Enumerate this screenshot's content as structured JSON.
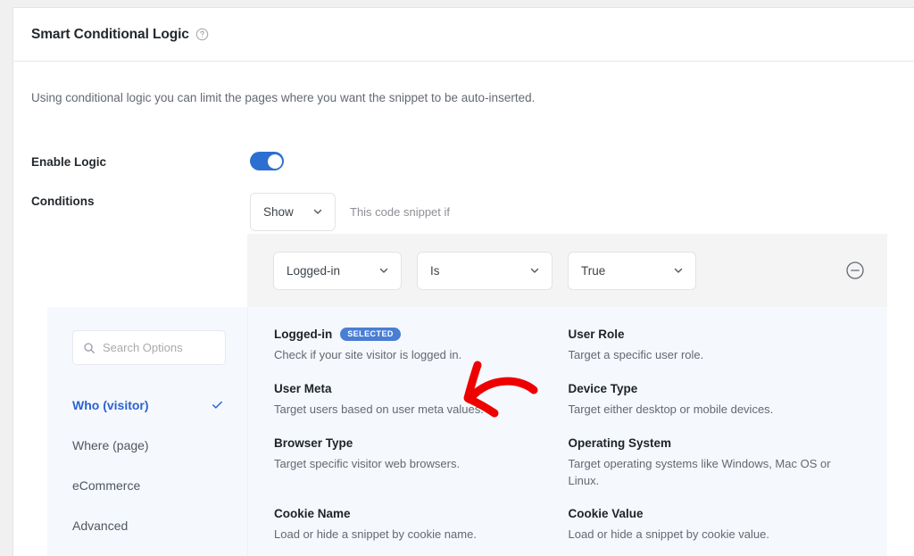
{
  "header": {
    "title": "Smart Conditional Logic",
    "help_icon": "help-circle-icon"
  },
  "intro": "Using conditional logic you can limit the pages where you want the snippet to be auto-inserted.",
  "fields": {
    "enable_logic_label": "Enable Logic",
    "enable_logic_value": "on",
    "conditions_label": "Conditions",
    "show_select_value": "Show",
    "show_hint": "This code snippet if"
  },
  "condition_row": {
    "subject_value": "Logged-in",
    "operator_value": "Is",
    "value_value": "True",
    "remove_icon": "minus-circle-icon"
  },
  "filter_panel": {
    "search_placeholder": "Search Options",
    "search_value": "",
    "search_icon": "search-icon",
    "items": [
      {
        "label": "Who (visitor)",
        "active": true,
        "check": "check-icon"
      },
      {
        "label": "Where (page)",
        "active": false
      },
      {
        "label": "eCommerce",
        "active": false
      },
      {
        "label": "Advanced",
        "active": false
      }
    ]
  },
  "options_panel": {
    "badge_selected_label": "Selected",
    "options": [
      {
        "title": "Logged-in",
        "desc": "Check if your site visitor is logged in.",
        "selected": true
      },
      {
        "title": "User Role",
        "desc": "Target a specific user role.",
        "selected": false
      },
      {
        "title": "User Meta",
        "desc": "Target users based on user meta values.",
        "selected": false
      },
      {
        "title": "Device Type",
        "desc": "Target either desktop or mobile devices.",
        "selected": false
      },
      {
        "title": "Browser Type",
        "desc": "Target specific visitor web browsers.",
        "selected": false
      },
      {
        "title": "Operating System",
        "desc": "Target operating systems like Windows, Mac OS or Linux.",
        "selected": false
      },
      {
        "title": "Cookie Name",
        "desc": "Load or hide a snippet by cookie name.",
        "selected": false
      },
      {
        "title": "Cookie Value",
        "desc": "Load or hide a snippet by cookie value.",
        "selected": false
      }
    ]
  },
  "annotation": {
    "type": "red-arrow",
    "points_at": "User Meta",
    "color": "#ee0000"
  },
  "colors": {
    "accent": "#2d6fd0",
    "badge": "#4a7ed4",
    "panel_bg": "#f5f8fd",
    "strip_bg": "#f4f4f4"
  }
}
